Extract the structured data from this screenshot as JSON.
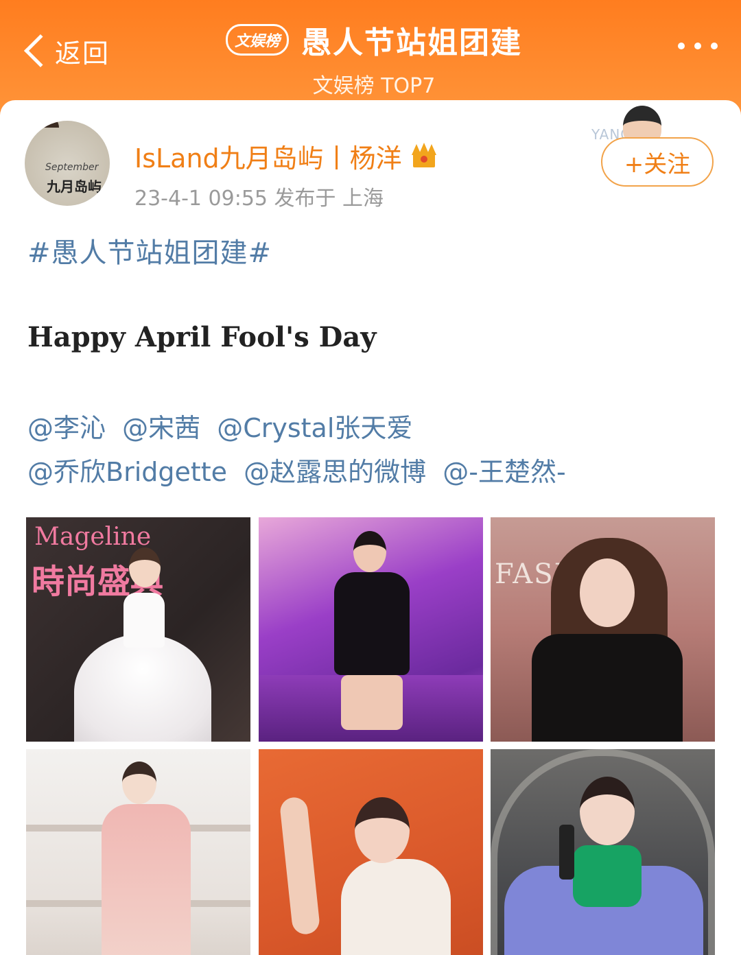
{
  "header": {
    "back_label": "返回",
    "badge": "文娱榜",
    "title": "愚人节站姐团建",
    "subtitle": "文娱榜 TOP7"
  },
  "post": {
    "avatar_brand": "九月岛屿",
    "avatar_script": "September",
    "author": "IsLand九月岛屿丨杨洋",
    "meta": "23-4-1 09:55  发布于 上海",
    "follow_label": "+关注",
    "follow_deco_text": "YANG",
    "hashtag": "#愚人节站姐团建#",
    "headline": "Happy April Fool's Day",
    "mentions_line1": [
      "@李沁",
      "@宋茜",
      "@Crystal张天爱"
    ],
    "mentions_line2": [
      "@乔欣Bridgette",
      "@赵露思的微博",
      "@-王楚然-"
    ]
  },
  "photos": [
    {
      "sign_top": "Mageline",
      "sign_bottom": "時尚盛典"
    },
    {},
    {
      "sign": "FASHION"
    },
    {},
    {},
    {}
  ],
  "colors": {
    "accent": "#ff8a2a",
    "username": "#f07f16",
    "link": "#527ca6",
    "meta": "#9a9a9a"
  },
  "icons": [
    "back-chevron-icon",
    "more-dots-icon",
    "vip-crown-icon"
  ]
}
